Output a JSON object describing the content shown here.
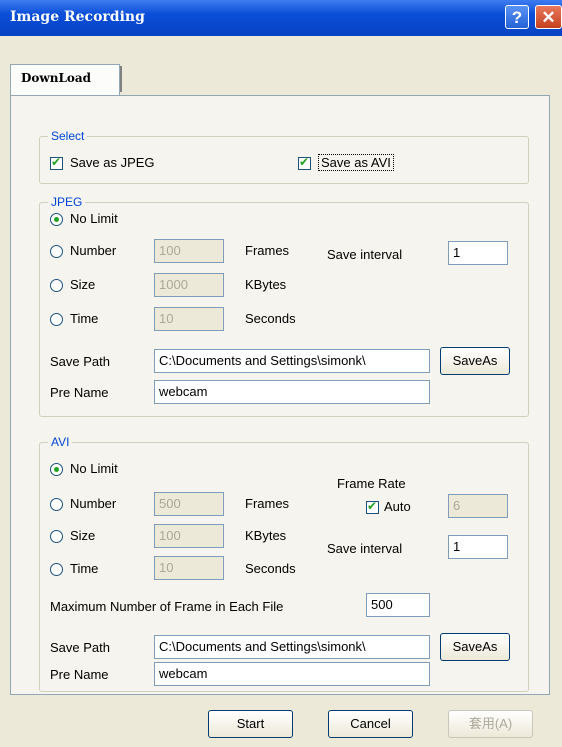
{
  "window": {
    "title": "Image Recording",
    "help_icon": "?",
    "close_icon": "✕"
  },
  "tabs": [
    {
      "label": "DownLoad"
    }
  ],
  "select": {
    "legend": "Select",
    "save_jpeg": {
      "label": "Save as JPEG",
      "checked": true
    },
    "save_avi": {
      "label": "Save as AVI",
      "checked": true
    }
  },
  "jpeg": {
    "legend": "JPEG",
    "options": [
      {
        "label": "No Limit",
        "value": "",
        "unit": "",
        "selected": true
      },
      {
        "label": "Number",
        "value": "100",
        "unit": "Frames",
        "selected": false
      },
      {
        "label": "Size",
        "value": "1000",
        "unit": "KBytes",
        "selected": false
      },
      {
        "label": "Time",
        "value": "10",
        "unit": "Seconds",
        "selected": false
      }
    ],
    "save_interval_label": "Save interval",
    "save_interval_value": "1",
    "save_path_label": "Save Path",
    "save_path_value": "C:\\Documents and Settings\\simonk\\",
    "save_as_button": "SaveAs",
    "pre_name_label": "Pre Name",
    "pre_name_value": "webcam"
  },
  "avi": {
    "legend": "AVI",
    "options": [
      {
        "label": "No Limit",
        "value": "",
        "unit": "",
        "selected": true
      },
      {
        "label": "Number",
        "value": "500",
        "unit": "Frames",
        "selected": false
      },
      {
        "label": "Size",
        "value": "100",
        "unit": "KBytes",
        "selected": false
      },
      {
        "label": "Time",
        "value": "10",
        "unit": "Seconds",
        "selected": false
      }
    ],
    "frame_rate_label": "Frame Rate",
    "auto_label": "Auto",
    "auto_checked": true,
    "frame_rate_value": "6",
    "save_interval_label": "Save interval",
    "save_interval_value": "1",
    "max_frames_label": "Maximum Number of Frame in Each File",
    "max_frames_value": "500",
    "save_path_label": "Save Path",
    "save_path_value": "C:\\Documents and Settings\\simonk\\",
    "save_as_button": "SaveAs",
    "pre_name_label": "Pre Name",
    "pre_name_value": "webcam"
  },
  "footer": {
    "start_button": "Start",
    "cancel_button": "Cancel",
    "apply_button": "套用(A)"
  }
}
